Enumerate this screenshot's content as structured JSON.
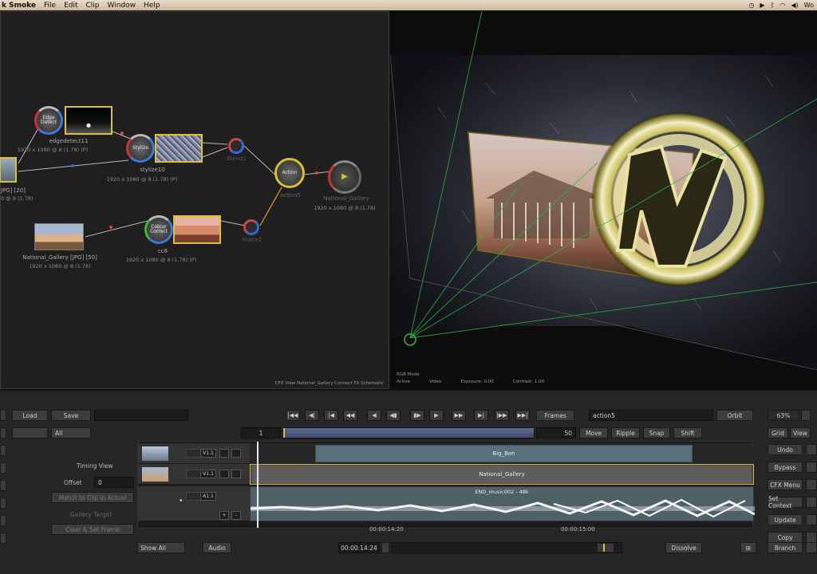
{
  "menubar": {
    "app": "k Smoke",
    "items": [
      "File",
      "Edit",
      "Clip",
      "Window",
      "Help"
    ],
    "right": "Wo"
  },
  "schematic": {
    "caption": "CFX View National_Gallery Connect FX Schematic",
    "nodes": {
      "edge_detect": {
        "label": "edgedetect11",
        "size": "1920 x 1080 @ 8 (1.78) (P)",
        "text": "Edge Detect"
      },
      "stylize": {
        "label": "stylize10",
        "size": "1920 x 1080 @ 8 (1.78) (P)",
        "text": "Stylize"
      },
      "action": {
        "label": "action5",
        "text": "Action"
      },
      "action_out": {
        "label": "National_Gallery",
        "size": "1920 x 1080 @ 8 (1.78)"
      },
      "ccx": {
        "label": "cc8",
        "size": "1920 x 1080 @ 8 (1.78) (P)",
        "text": "Colour Correct"
      },
      "national_gallery": {
        "label": "National_Gallery [JPG] [50]",
        "size": "1920 x 1080 @ 8 (1.78)"
      },
      "left_clip": {
        "label": "JPG] [20]",
        "size": "0 @ 8 (1.78)"
      },
      "mini1": "Blend1",
      "mini2": "Matte2"
    }
  },
  "viewer": {
    "mode": "RGB Mode",
    "row": [
      "Active",
      "Video",
      "Exposure: 0.00",
      "Contrast: 1.00"
    ]
  },
  "controls": {
    "load": "Load",
    "save": "Save",
    "pin_all": "All",
    "frames_label": "Frames",
    "node_name": "action5",
    "orbit": "Orbit",
    "zoom": "63%",
    "frame_start": "1",
    "frame_end": "50",
    "move": "Move",
    "ripple": "Ripple",
    "snap": "Snap",
    "shift": "Shift",
    "timing_view": "Timing View",
    "offset_label": "Offset",
    "offset_value": "0",
    "btn_match": "Match to Clip in Actual",
    "gallery_target": "Gallery Target",
    "btn_clear": "Clear & Set Frame",
    "show_all": "Show All",
    "audio": "Audio",
    "timecode": "00:00:14:24",
    "dissolve": "Dissolve",
    "branch": "Branch"
  },
  "right_buttons": [
    "Undo",
    "Bypass",
    "CFX Menu",
    "Set Context",
    "Update",
    "Copy"
  ],
  "right_top": [
    "Grid",
    "View"
  ],
  "transport": [
    "|◀◀",
    "◀|",
    "|◀",
    "◀◀",
    "◀",
    "◀▮",
    "▮▶",
    "▶",
    "▶▶",
    "▶|",
    "|▶▶",
    "▶▶|"
  ],
  "timeline": {
    "tracks": [
      {
        "id": "V1.1",
        "clip": "Big_Ben"
      },
      {
        "id": "V1.1",
        "clip": "National_Gallery"
      },
      {
        "id": "A1.1",
        "clip": "END_music002 - 48k"
      }
    ],
    "ruler": [
      "00:00:14:20",
      "00:00:15:00"
    ]
  }
}
